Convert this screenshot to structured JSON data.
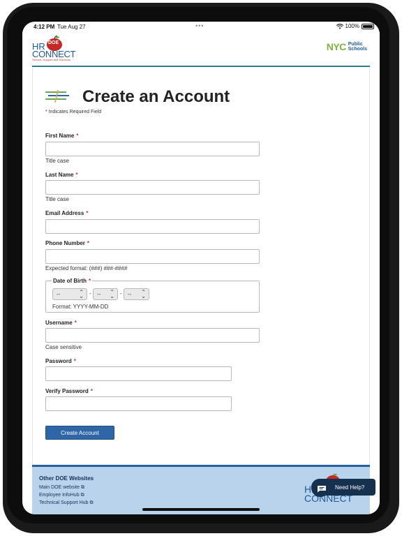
{
  "status_bar": {
    "time": "4:12 PM",
    "date": "Tue Aug 27",
    "dots": "•••",
    "battery": "100%"
  },
  "header": {
    "logo_apple_text": "DOE",
    "logo_hr": "HR",
    "logo_connect": "CONNECT",
    "logo_tagline": "Service, Support and Solutions",
    "nyc_mark": "NYC",
    "nyc_line1": "Public",
    "nyc_line2": "Schools"
  },
  "page": {
    "title": "Create an Account",
    "required_note": "* Indicates Required Field",
    "required_star": "*"
  },
  "form": {
    "first_name": {
      "label": "First Name",
      "value": "",
      "hint": "Title case"
    },
    "last_name": {
      "label": "Last Name",
      "value": "",
      "hint": "Title case"
    },
    "email": {
      "label": "Email Address",
      "value": ""
    },
    "phone": {
      "label": "Phone Number",
      "value": "",
      "hint": "Expected format: (###) ###-####"
    },
    "dob": {
      "legend": "Date of Birth",
      "year": "--",
      "month": "--",
      "day": "--",
      "separator": "-",
      "format": "Format: YYYY-MM-DD"
    },
    "username": {
      "label": "Username",
      "value": "",
      "hint": "Case sensitive"
    },
    "password": {
      "label": "Password",
      "value": ""
    },
    "verify_password": {
      "label": "Verify Password",
      "value": ""
    },
    "submit_label": "Create Account"
  },
  "footer": {
    "heading": "Other DOE Websites",
    "links": [
      "Main DOE website",
      "Employee InfoHub",
      "Technical Support Hub"
    ],
    "logo_hr": "HR",
    "logo_connect": "CONNECT"
  },
  "help": {
    "label": "Need Help?"
  },
  "colors": {
    "accent": "#2e66a8",
    "header_rule": "#2a7c8c",
    "footer_bg": "#b9d3ec",
    "required": "#c0392b"
  }
}
